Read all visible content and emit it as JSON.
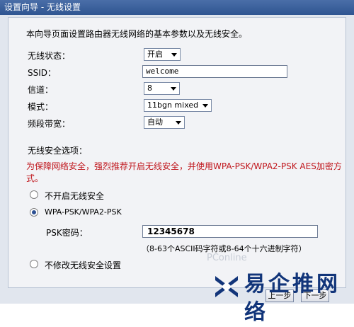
{
  "window": {
    "title": "设置向导 - 无线设置"
  },
  "intro": "本向导页面设置路由器无线网络的基本参数以及无线安全。",
  "form": {
    "wireless_status": {
      "label": "无线状态：",
      "value": "开启"
    },
    "ssid": {
      "label": "SSID：",
      "value": "welcome"
    },
    "channel": {
      "label": "信道：",
      "value": "8"
    },
    "mode": {
      "label": "模式：",
      "value": "11bgn mixed"
    },
    "bandwidth": {
      "label": "频段带宽：",
      "value": "自动"
    }
  },
  "security": {
    "section_title": "无线安全选项：",
    "warning": "为保障网络安全，强烈推荐开启无线安全，并使用WPA-PSK/WPA2-PSK AES加密方式。",
    "options": [
      {
        "label": "不开启无线安全",
        "checked": false
      },
      {
        "label": "WPA-PSK/WPA2-PSK",
        "checked": true
      },
      {
        "label": "不修改无线安全设置",
        "checked": false
      }
    ],
    "psk_label": "PSK密码：",
    "psk_value": "12345678",
    "psk_hint": "（8-63个ASCII码字符或8-64个十六进制字符）"
  },
  "buttons": {
    "prev": "上一步",
    "next": "下一步"
  },
  "watermark": {
    "text": "易企推网络",
    "pc_mark": "PConline"
  },
  "colors": {
    "titlebar": "#3a5f9e",
    "warning": "#c0161c",
    "panel": "#f2f3f6",
    "watermark": "#12357a"
  }
}
